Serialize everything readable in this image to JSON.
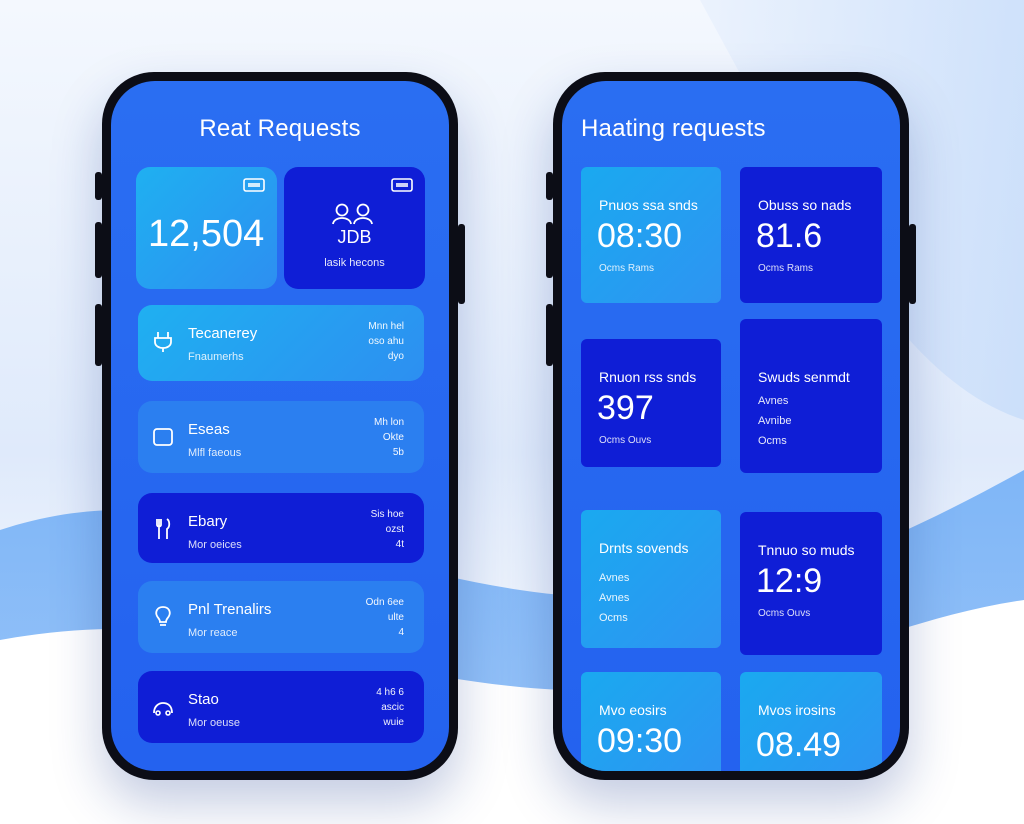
{
  "left_screen": {
    "title": "Reat Requests",
    "stat_a": {
      "value": "12,504"
    },
    "stat_b": {
      "code": "JDB",
      "caption": "lasik hecons"
    },
    "list": [
      {
        "icon": "plug-icon",
        "title": "Tecanerey",
        "sub": "Fnaumerhs",
        "right": [
          "Mnn hel",
          "oso ahu",
          "dyo"
        ]
      },
      {
        "icon": "box-icon",
        "title": "Eseas",
        "sub": "Mlfl faeous",
        "right": [
          "Mh lon",
          "Okte",
          "5b"
        ]
      },
      {
        "icon": "tool-icon",
        "title": "Ebary",
        "sub": "Mor oeices",
        "right": [
          "Sis hoe",
          "ozst",
          "4t"
        ]
      },
      {
        "icon": "bulb-icon",
        "title": "Pnl Trenalirs",
        "sub": "Mor reace",
        "right": [
          "Odn 6ee",
          "ulte",
          "4"
        ]
      },
      {
        "icon": "cloud-icon",
        "title": "Stao",
        "sub": "Mor oeuse",
        "right": [
          "4 h6 6",
          "ascic",
          "wuie"
        ]
      }
    ]
  },
  "right_screen": {
    "title": "Haating requests",
    "tiles": [
      {
        "label": "Pnuos ssa snds",
        "value": "08:30",
        "sub": "Ocms  Rams"
      },
      {
        "label": "Obuss so nads",
        "value": "81.6",
        "sub": "Ocms  Rams"
      },
      {
        "label": "Rnuon rss snds",
        "value": "397",
        "sub": "Ocms  Ouvs"
      },
      {
        "label": "Swuds senmdt",
        "lines": [
          "Avnes",
          "Avnibe",
          "Ocms"
        ]
      },
      {
        "label": "Drnts sovends",
        "lines": [
          "Avnes",
          "Avnes",
          "Ocms"
        ]
      },
      {
        "label": "Tnnuo so muds",
        "value": "12:9",
        "sub": "Ocms  Ouvs"
      },
      {
        "label": "Mvo eosirs",
        "value": "09:30"
      },
      {
        "label": "Mvos irosins",
        "value": "08.49"
      }
    ]
  },
  "colors": {
    "screen": "#2a6ef2",
    "card_light": "#1fb0f1",
    "card_dark": "#0f1ed6",
    "frame": "#0c0d16"
  }
}
